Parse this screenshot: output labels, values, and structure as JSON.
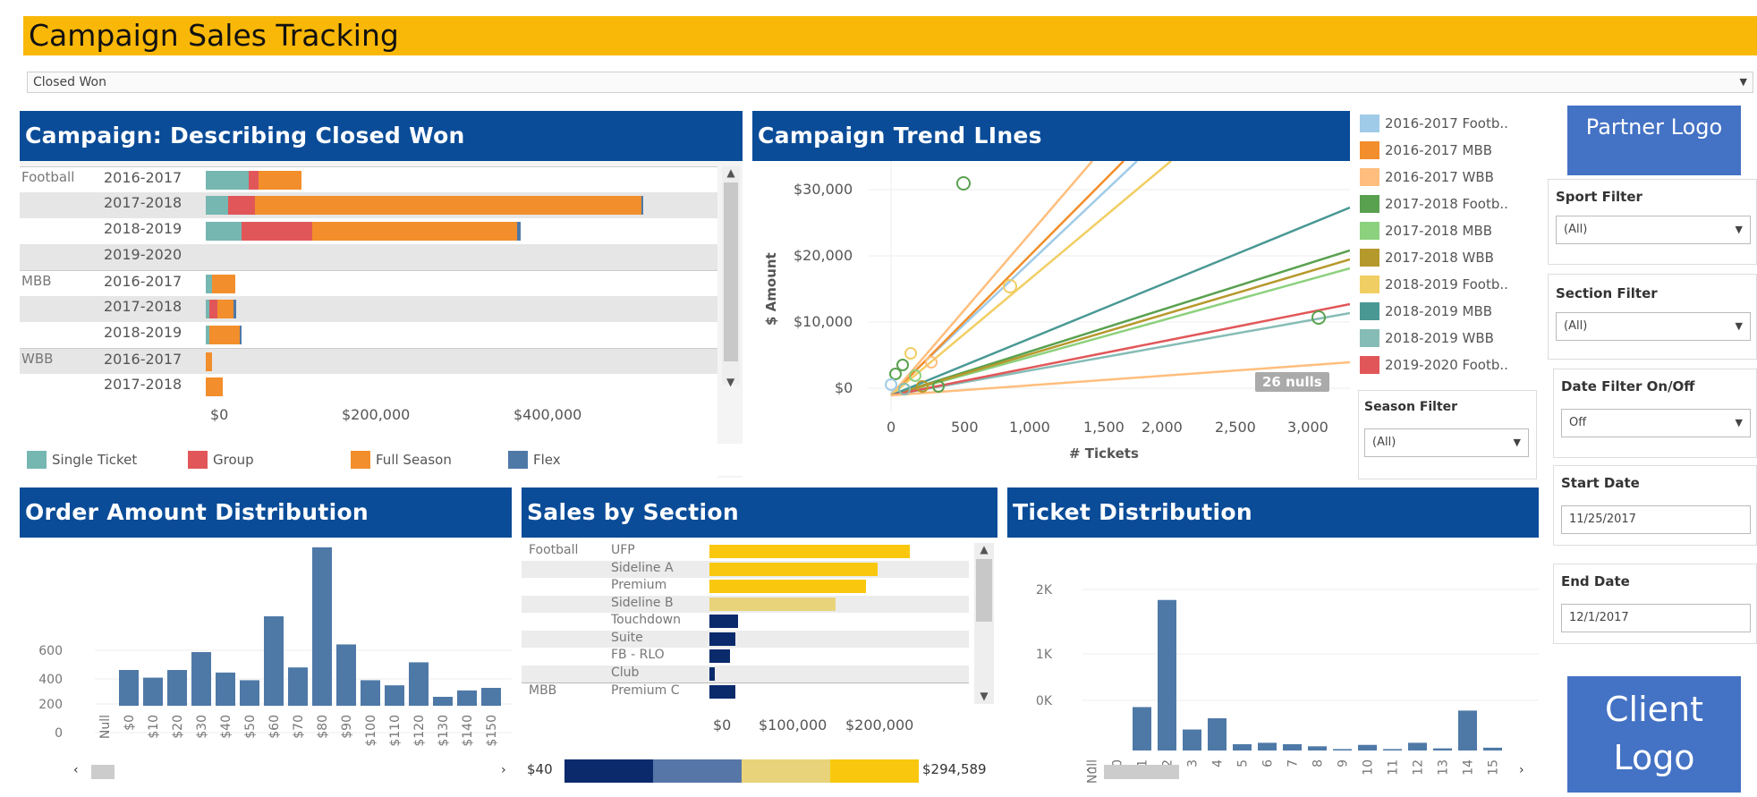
{
  "title": "Campaign Sales Tracking",
  "status_filter": {
    "value": "Closed Won"
  },
  "campaign_panel": {
    "title": "Campaign:  Describing Closed Won",
    "rows": [
      {
        "group": "Football",
        "year": "2016-2017",
        "single": 55,
        "group_v": 12,
        "full": 55,
        "flex": 0
      },
      {
        "group": "",
        "year": "2017-2018",
        "single": 28,
        "group_v": 35,
        "full": 490,
        "flex": 3
      },
      {
        "group": "",
        "year": "2018-2019",
        "single": 45,
        "group_v": 90,
        "full": 260,
        "flex": 5
      },
      {
        "group": "",
        "year": "2019-2020",
        "single": 0,
        "group_v": 0,
        "full": 0,
        "flex": 0
      },
      {
        "group": "MBB",
        "year": "2016-2017",
        "single": 8,
        "group_v": 0,
        "full": 30,
        "flex": 0
      },
      {
        "group": "",
        "year": "2017-2018",
        "single": 5,
        "group_v": 10,
        "full": 20,
        "flex": 4
      },
      {
        "group": "",
        "year": "2018-2019",
        "single": 5,
        "group_v": 0,
        "full": 38,
        "flex": 3
      },
      {
        "group": "WBB",
        "year": "2016-2017",
        "single": 0,
        "group_v": 0,
        "full": 8,
        "flex": 0
      },
      {
        "group": "",
        "year": "2017-2018",
        "single": 0,
        "group_v": 0,
        "full": 22,
        "flex": 0
      }
    ],
    "axis_ticks": [
      "$0",
      "$200,000",
      "$400,000"
    ],
    "legend": [
      {
        "label": "Single Ticket",
        "color": "#76b7b2"
      },
      {
        "label": "Group",
        "color": "#e15759"
      },
      {
        "label": "Full Season",
        "color": "#f28e2b"
      },
      {
        "label": "Flex",
        "color": "#4e79a7"
      }
    ]
  },
  "trend_panel": {
    "title": "Campaign Trend LInes",
    "ylabel": "$ Amount",
    "xlabel": "# Tickets",
    "y_ticks": [
      "$30,000",
      "$20,000",
      "$10,000",
      "$0"
    ],
    "x_ticks": [
      "0",
      "500",
      "1,000",
      "1,500",
      "2,000",
      "2,500",
      "3,000"
    ],
    "nulls_badge": "26 nulls"
  },
  "chart_data": [
    {
      "type": "bar",
      "title": "Order Amount Distribution",
      "categories": [
        "Null",
        "$0",
        "$10",
        "$20",
        "$30",
        "$40",
        "$50",
        "$60",
        "$70",
        "$80",
        "$90",
        "$100",
        "$110",
        "$120",
        "$130",
        "$140",
        "$150"
      ],
      "values": [
        0,
        140,
        110,
        140,
        210,
        130,
        100,
        350,
        150,
        620,
        240,
        100,
        80,
        170,
        35,
        60,
        70
      ],
      "y_ticks": [
        "600",
        "400",
        "200",
        "0"
      ],
      "ylim": [
        0,
        700
      ]
    },
    {
      "type": "bar",
      "title": "Ticket Distribution",
      "categories": [
        "Null",
        "0",
        "1",
        "2",
        "3",
        "4",
        "5",
        "6",
        "7",
        "8",
        "9",
        "10",
        "11",
        "12",
        "13",
        "14",
        "15"
      ],
      "values": [
        0,
        0,
        620,
        2150,
        300,
        460,
        90,
        110,
        90,
        60,
        20,
        80,
        20,
        110,
        30,
        570,
        40
      ],
      "y_ticks": [
        "2K",
        "1K",
        "0K"
      ],
      "ylim": [
        0,
        2300
      ]
    }
  ],
  "trend_legend": [
    {
      "label": "2016-2017 Footb..",
      "color": "#a0cbe8"
    },
    {
      "label": "2016-2017 MBB",
      "color": "#f28e2b"
    },
    {
      "label": "2016-2017 WBB",
      "color": "#ffbe7d"
    },
    {
      "label": "2017-2018 Footb..",
      "color": "#59a14f"
    },
    {
      "label": "2017-2018 MBB",
      "color": "#8cd17d"
    },
    {
      "label": "2017-2018 WBB",
      "color": "#b6992d"
    },
    {
      "label": "2018-2019 Footb..",
      "color": "#f1ce63"
    },
    {
      "label": "2018-2019 MBB",
      "color": "#499894"
    },
    {
      "label": "2018-2019 WBB",
      "color": "#86bcb6"
    },
    {
      "label": "2019-2020 Footb..",
      "color": "#e15759"
    }
  ],
  "season_filter": {
    "label": "Season Filter",
    "value": "(All)"
  },
  "sidebar": {
    "partner_logo": "Partner Logo",
    "client_logo": "Client Logo",
    "sport_filter": {
      "label": "Sport Filter",
      "value": "(All)"
    },
    "section_filter": {
      "label": "Section Filter",
      "value": "(All)"
    },
    "date_toggle": {
      "label": "Date Filter On/Off",
      "value": "Off"
    },
    "start_date": {
      "label": "Start Date",
      "value": "11/25/2017"
    },
    "end_date": {
      "label": "End Date",
      "value": "12/1/2017"
    }
  },
  "sales_section": {
    "title": "Sales by Section",
    "rows": [
      {
        "group": "Football",
        "section": "UFP",
        "value": 295000,
        "color": "#f9c80e"
      },
      {
        "group": "",
        "section": "Sideline A",
        "value": 248000,
        "color": "#f9c80e"
      },
      {
        "group": "",
        "section": "Premium",
        "value": 230000,
        "color": "#f9c80e"
      },
      {
        "group": "",
        "section": "Sideline B",
        "value": 185000,
        "color": "#e9d37a"
      },
      {
        "group": "",
        "section": "Touchdown",
        "value": 42000,
        "color": "#0a2a6c"
      },
      {
        "group": "",
        "section": "Suite",
        "value": 38000,
        "color": "#0a2a6c"
      },
      {
        "group": "",
        "section": "FB - RLO",
        "value": 30000,
        "color": "#0a2a6c"
      },
      {
        "group": "",
        "section": "Club",
        "value": 8000,
        "color": "#0a2a6c"
      },
      {
        "group": "MBB",
        "section": "Premium C",
        "value": 38000,
        "color": "#0a2a6c"
      }
    ],
    "axis_ticks": [
      "$0",
      "$100,000",
      "$200,000"
    ],
    "scale_min": "$40",
    "scale_max": "$294,589"
  }
}
